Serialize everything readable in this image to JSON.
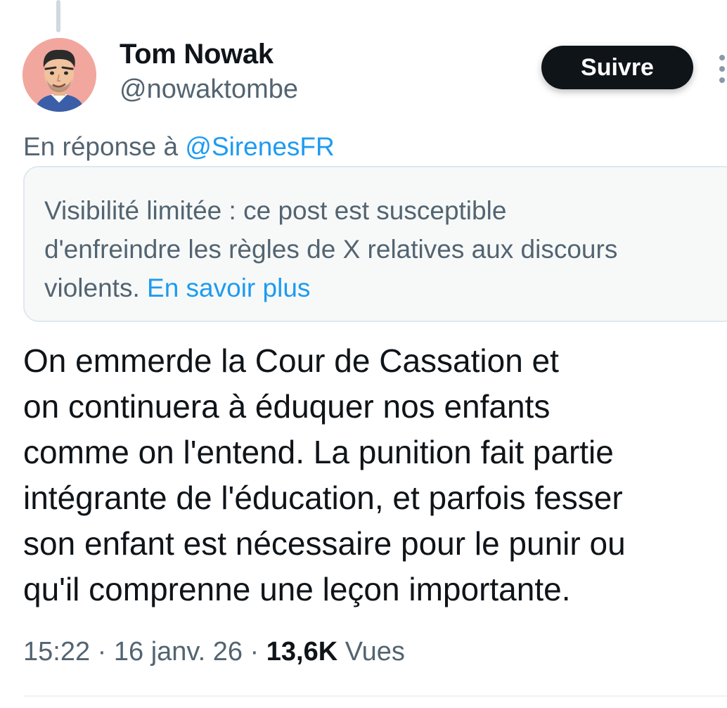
{
  "author": {
    "display_name": "Tom Nowak",
    "handle": "@nowaktombe"
  },
  "actions": {
    "follow_label": "Suivre",
    "more_icon": "more-vertical-icon"
  },
  "reply": {
    "prefix": "En réponse à ",
    "mention": "@SirenesFR"
  },
  "notice": {
    "lines": [
      "Visibilité limitée : ce post est susceptible",
      "d'enfreindre les règles de X relatives aux discours",
      "violents. "
    ],
    "link_label": "En savoir plus"
  },
  "tweet": {
    "lines": [
      "On emmerde la Cour de Cassation et",
      "on continuera à éduquer nos enfants",
      "comme on l'entend. La punition fait partie",
      "intégrante de l'éducation, et parfois fesser",
      "son enfant est nécessaire pour le punir ou",
      "qu'il comprenne une leçon importante."
    ]
  },
  "meta": {
    "time": "15:22",
    "separator": " · ",
    "date": "16 janv. 26",
    "views_count": "13,6K",
    "views_label": " Vues"
  },
  "colors": {
    "accent": "#1d9bf0",
    "text": "#0f1419",
    "muted": "#536471",
    "avatar_bg": "#f2a79e"
  }
}
